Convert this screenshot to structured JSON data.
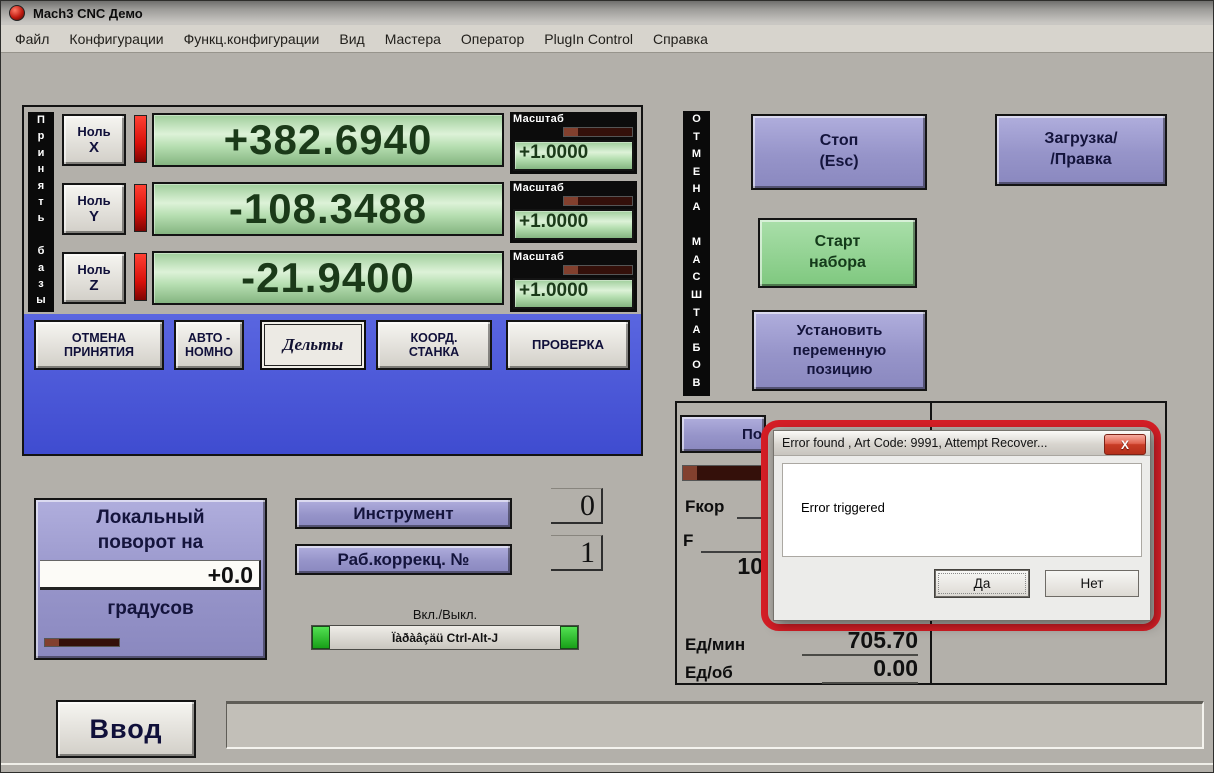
{
  "palette": {
    "purple": "#9694c9",
    "green_button": "#8fd08f",
    "dro_green": "#bfe3bb",
    "blue_panel": "#4a57d9",
    "alert_red": "#d51e26",
    "indicator_red": "#e8201c"
  },
  "window": {
    "title": "Mach3 CNC  Демо"
  },
  "menu": {
    "items": [
      "Файл",
      "Конфигурации",
      "Функц.конфигурации",
      "Вид",
      "Мастера",
      "Оператор",
      "PlugIn Control",
      "Справка"
    ]
  },
  "dro": {
    "accept_strip": "П\nр\nи\nн\nя\nт\nь\n\nб\nа\nз\nы",
    "zero_label": "Ноль",
    "axes": [
      {
        "axis": "X",
        "value": "+382.6940",
        "scale_label": "Масштаб",
        "scale_value": "+1.0000"
      },
      {
        "axis": "Y",
        "value": "-108.3488",
        "scale_label": "Масштаб",
        "scale_value": "+1.0000"
      },
      {
        "axis": "Z",
        "value": "-21.9400",
        "scale_label": "Масштаб",
        "scale_value": "+1.0000"
      }
    ],
    "mode_buttons": [
      "ОТМЕНА\nПРИНЯТИЯ",
      "АВТО -\nНОМНО",
      "Дельты",
      "КООРД.\nСТАНКА",
      "ПРОВЕРКА"
    ]
  },
  "scale_cancel_strip": "О\nТ\nМ\nЕ\nН\nА\n\nМ\nА\nС\nШ\nТ\nА\nБ\nО\nВ",
  "action_buttons": {
    "stop": "Стоп\n(Esc)",
    "load_edit": "Загрузка/\n/Правка",
    "start": "Старт\nнабора",
    "set_position": "Установить\nпеременную\nпозицию"
  },
  "feed": {
    "header_partial": "По",
    "fkor_label": "Fкор",
    "f_label": "F",
    "partial_value": "10",
    "units_min_label": "Ед/мин",
    "units_min_value": "705.70",
    "units_rev_label": "Ед/об",
    "units_rev_value": "0.00"
  },
  "rotation": {
    "title": "Локальный\nповорот на",
    "value": "+0.0",
    "units": "градусов"
  },
  "tool": {
    "label": "Инструмент",
    "value": "0"
  },
  "work_offset": {
    "label": "Раб.коррекц. №",
    "value": "1"
  },
  "toggle": {
    "caption": "Вкл./Выкл.",
    "button_label": "Ïàðàâçäü Ctrl-Alt-J"
  },
  "dialog": {
    "title": "Error found , Art Code: 9991, Attempt Recover...",
    "message": "Error triggered",
    "yes_label": "Да",
    "no_label": "Нет",
    "close_icon": "X"
  },
  "input_bar": {
    "button_label": "Ввод"
  }
}
